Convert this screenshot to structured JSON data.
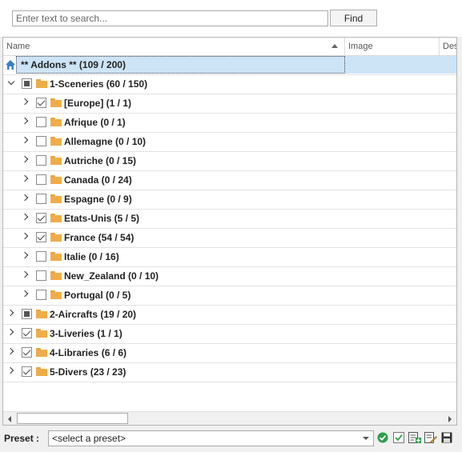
{
  "search": {
    "placeholder": "Enter text to search...",
    "value": "",
    "find_label": "Find"
  },
  "columns": {
    "name": "Name",
    "image": "Image",
    "description": "Des"
  },
  "tree": [
    {
      "label": "** Addons ** (109 / 200)",
      "level": 0,
      "type": "root",
      "selected": true
    },
    {
      "label": "1-Sceneries (60 / 150)",
      "level": 1,
      "expander": "expanded",
      "check": "partial"
    },
    {
      "label": "[Europe] (1 / 1)",
      "level": 2,
      "expander": "collapsed",
      "check": "checked"
    },
    {
      "label": "Afrique (0 / 1)",
      "level": 2,
      "expander": "collapsed",
      "check": "unchecked"
    },
    {
      "label": "Allemagne (0 / 10)",
      "level": 2,
      "expander": "collapsed",
      "check": "unchecked"
    },
    {
      "label": "Autriche (0 / 15)",
      "level": 2,
      "expander": "collapsed",
      "check": "unchecked"
    },
    {
      "label": "Canada (0 / 24)",
      "level": 2,
      "expander": "collapsed",
      "check": "unchecked"
    },
    {
      "label": "Espagne (0 / 9)",
      "level": 2,
      "expander": "collapsed",
      "check": "unchecked"
    },
    {
      "label": "Etats-Unis (5 / 5)",
      "level": 2,
      "expander": "collapsed",
      "check": "checked"
    },
    {
      "label": "France (54 / 54)",
      "level": 2,
      "expander": "collapsed",
      "check": "checked"
    },
    {
      "label": "Italie (0 / 16)",
      "level": 2,
      "expander": "collapsed",
      "check": "unchecked"
    },
    {
      "label": "New_Zealand (0 / 10)",
      "level": 2,
      "expander": "collapsed",
      "check": "unchecked"
    },
    {
      "label": "Portugal (0 / 5)",
      "level": 2,
      "expander": "collapsed",
      "check": "unchecked"
    },
    {
      "label": "2-Aircrafts (19 / 20)",
      "level": 1,
      "expander": "collapsed",
      "check": "partial"
    },
    {
      "label": "3-Liveries (1 / 1)",
      "level": 1,
      "expander": "collapsed",
      "check": "checked"
    },
    {
      "label": "4-Libraries (6 / 6)",
      "level": 1,
      "expander": "collapsed",
      "check": "checked"
    },
    {
      "label": "5-Divers (23 / 23)",
      "level": 1,
      "expander": "collapsed",
      "check": "checked"
    }
  ],
  "preset": {
    "label": "Preset :",
    "value": "<select a preset>"
  },
  "toolbar_icons": [
    "apply-icon",
    "check-all-icon",
    "add-preset-icon",
    "edit-preset-icon",
    "save-icon"
  ],
  "colors": {
    "selection": "#cde4f7",
    "folder": "#f0ac48",
    "apply_green": "#2e9e4a"
  }
}
